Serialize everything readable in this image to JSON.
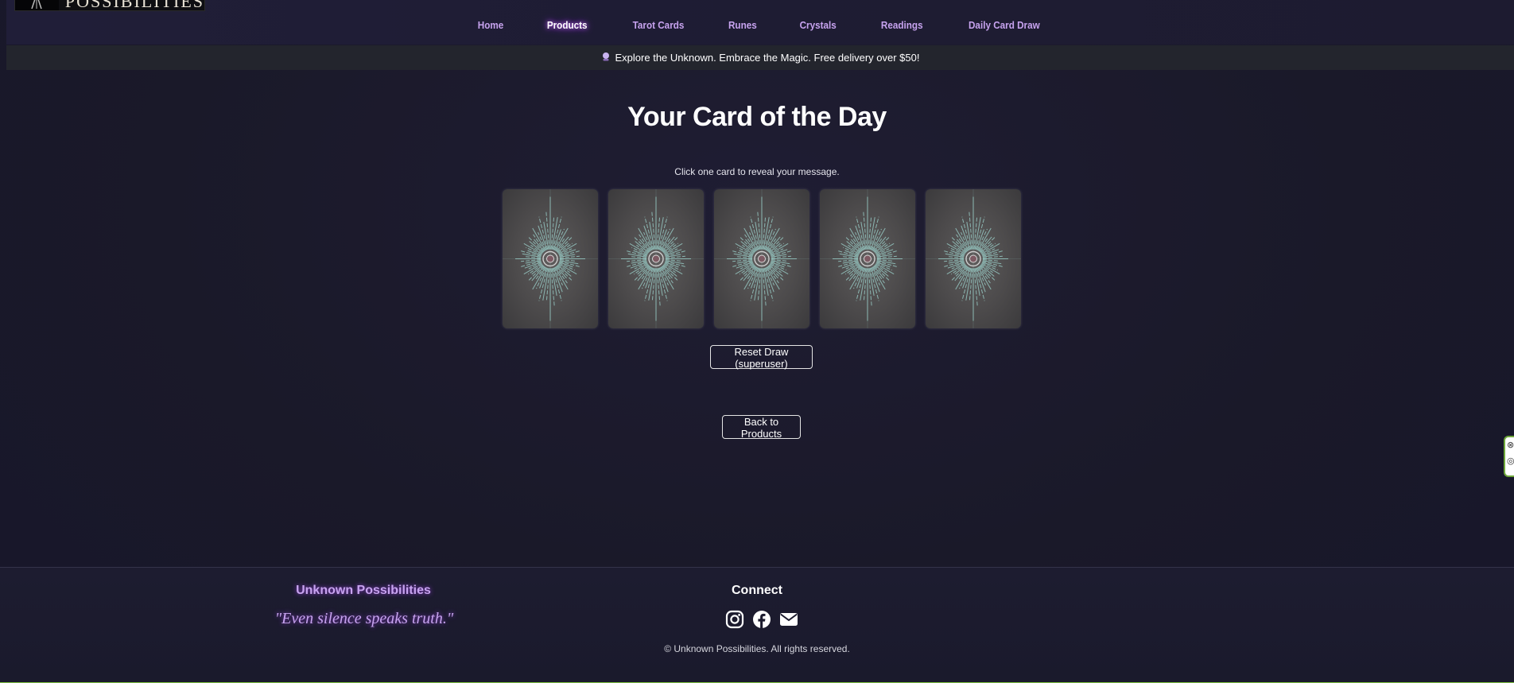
{
  "header": {
    "logo_text": "POSSIBILITIES",
    "nav": [
      {
        "label": "Home"
      },
      {
        "label": "Products",
        "active": true
      },
      {
        "label": "Tarot Cards"
      },
      {
        "label": "Runes"
      },
      {
        "label": "Crystals"
      },
      {
        "label": "Readings"
      },
      {
        "label": "Daily Card Draw"
      }
    ]
  },
  "banner": {
    "icon": "crystal-ball-icon",
    "text": "Explore the Unknown. Embrace the Magic. Free delivery over $50!"
  },
  "main": {
    "title": "Your Card of the Day",
    "instructions": "Click one card to reveal your message.",
    "cards": [
      {
        "name": "card-back"
      },
      {
        "name": "card-back"
      },
      {
        "name": "card-back"
      },
      {
        "name": "card-back"
      },
      {
        "name": "card-back"
      }
    ],
    "reset_label": "Reset Draw (superuser)",
    "back_label": "Back to Products"
  },
  "footer": {
    "brand": "Unknown Possibilities",
    "quote": "\"Even silence speaks truth.\"",
    "connect_title": "Connect",
    "social_icons": [
      "instagram-icon",
      "facebook-icon",
      "email-icon"
    ],
    "copyright": "© Unknown Possibilities. All rights reserved."
  },
  "colors": {
    "background": "#1b1a2d",
    "accent_purple": "#c7a3ef",
    "banner_bg": "#23252d",
    "card_bg": "#4c4a4b",
    "card_rays": "#9fd8d2"
  }
}
